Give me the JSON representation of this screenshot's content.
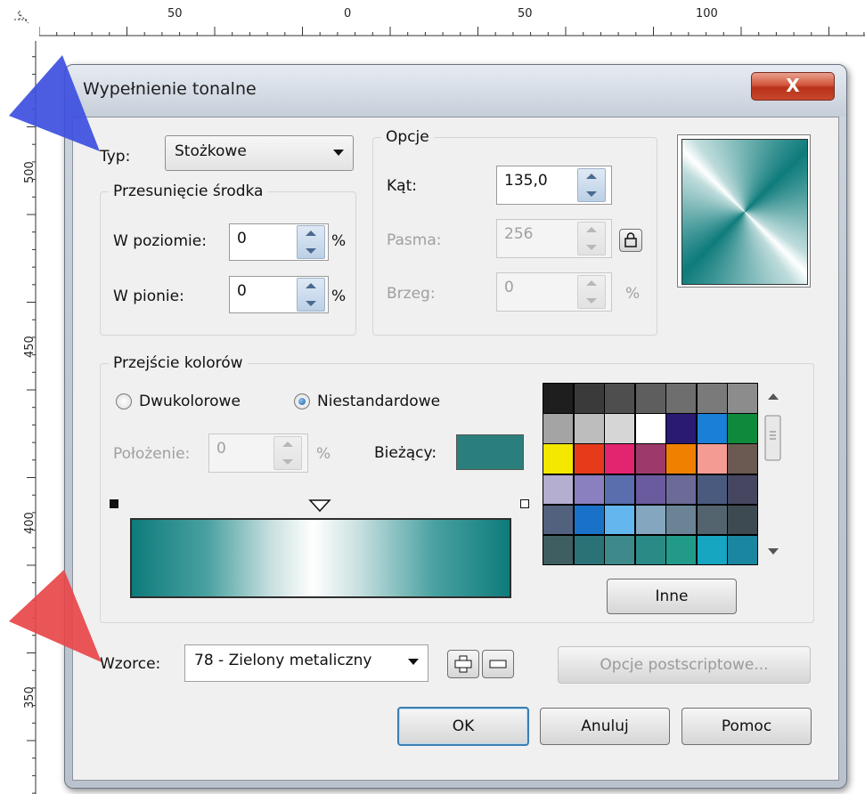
{
  "ruler": {
    "top_labels": [
      "50",
      "0",
      "50",
      "100"
    ],
    "left_labels": [
      "500",
      "450",
      "400",
      "350"
    ]
  },
  "dialog": {
    "title": "Wypełnienie tonalne",
    "close_label": "X"
  },
  "type": {
    "label": "Typ:",
    "value": "Stożkowe"
  },
  "center_offset": {
    "legend": "Przesunięcie środka",
    "horizontal_label": "W poziomie:",
    "horizontal_value": "0",
    "vertical_label": "W pionie:",
    "vertical_value": "0",
    "unit": "%"
  },
  "options": {
    "legend": "Opcje",
    "angle_label": "Kąt:",
    "angle_value": "135,0",
    "steps_label": "Pasma:",
    "steps_value": "256",
    "edge_label": "Brzeg:",
    "edge_value": "0",
    "edge_unit": "%"
  },
  "color_blend": {
    "legend": "Przejście kolorów",
    "two_color_label": "Dwukolorowe",
    "custom_label": "Niestandardowe",
    "selected": "custom",
    "position_label": "Położenie:",
    "position_value": "0",
    "position_unit": "%",
    "current_label": "Bieżący:",
    "current_color": "#2a7f7c",
    "other_button": "Inne"
  },
  "palette_colors": [
    [
      "#1e1e1e",
      "#3a3a3a",
      "#4e4e4e",
      "#5e5e5e",
      "#6e6e6e",
      "#7a7a7a",
      "#8c8c8c"
    ],
    [
      "#a4a4a4",
      "#bdbdbd",
      "#d6d6d6",
      "#ffffff",
      "#2a1a72",
      "#1a7fd6",
      "#0f8a3c"
    ],
    [
      "#f5e800",
      "#e63a1a",
      "#e3246e",
      "#9e3a6b",
      "#f08000",
      "#f49b94",
      "#6a5a52"
    ],
    [
      "#b4aed0",
      "#8a7fbf",
      "#5a6eae",
      "#6a5a9e",
      "#6c6a96",
      "#4a5a7e",
      "#464660"
    ],
    [
      "#52627e",
      "#1a72c8",
      "#64b6ee",
      "#84a6be",
      "#6a8496",
      "#54646e",
      "#3e4a52"
    ],
    [
      "#3e5e62",
      "#2a7276",
      "#3e8a8a",
      "#2a8a86",
      "#229a8a",
      "#16a6c2",
      "#1a86a0"
    ]
  ],
  "presets": {
    "label": "Wzorce:",
    "value": "78 - Zielony metaliczny",
    "postscript_button": "Opcje postscriptowe..."
  },
  "buttons": {
    "ok": "OK",
    "cancel": "Anuluj",
    "help": "Pomoc"
  },
  "colors": {
    "teal": "#0e7b7b",
    "blue_pointer": "#3d4fe0",
    "red_pointer": "#e8474a"
  }
}
